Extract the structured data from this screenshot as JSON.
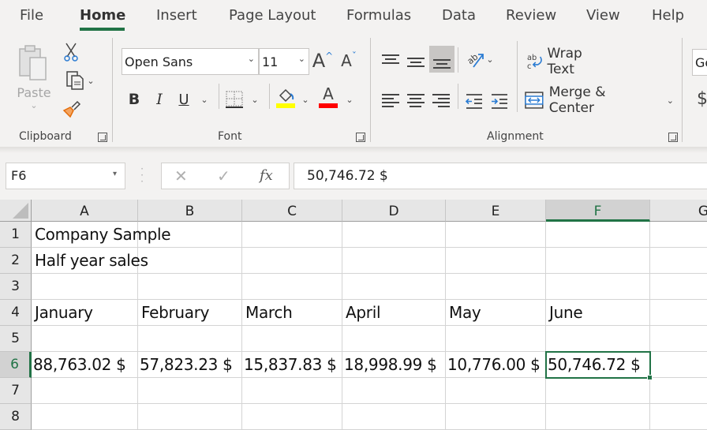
{
  "tabs": [
    {
      "label": "File",
      "active": false
    },
    {
      "label": "Home",
      "active": true
    },
    {
      "label": "Insert",
      "active": false
    },
    {
      "label": "Page Layout",
      "active": false
    },
    {
      "label": "Formulas",
      "active": false
    },
    {
      "label": "Data",
      "active": false
    },
    {
      "label": "Review",
      "active": false
    },
    {
      "label": "View",
      "active": false
    },
    {
      "label": "Help",
      "active": false
    }
  ],
  "ribbon": {
    "clipboard": {
      "label": "Clipboard",
      "paste_label": "Paste"
    },
    "font": {
      "label": "Font",
      "font_name": "Open Sans",
      "font_size": "11",
      "bold": "B",
      "italic": "I",
      "underline": "U",
      "fill_color": "#ffff00",
      "font_color": "#ff0000",
      "font_color_glyph": "A",
      "grow_glyph": "A",
      "shrink_glyph": "A"
    },
    "alignment": {
      "label": "Alignment",
      "wrap_text": "Wrap Text",
      "merge_center": "Merge & Center"
    },
    "number": {
      "format_value": "Ge",
      "currency_glyph": "$"
    }
  },
  "formula_bar": {
    "name_box": "F6",
    "fx_label": "fx",
    "cancel_glyph": "✕",
    "enter_glyph": "✓",
    "value": "50,746.72 $"
  },
  "sheet": {
    "columns": [
      "A",
      "B",
      "C",
      "D",
      "E",
      "F",
      "G"
    ],
    "selected_column": "F",
    "rows": [
      "1",
      "2",
      "3",
      "4",
      "5",
      "6",
      "7",
      "8"
    ],
    "selected_row": "6",
    "selected_cell": "F6",
    "cells": {
      "A1": "Company Sample",
      "A2": "Half year sales",
      "A4": "January",
      "B4": "February",
      "C4": "March",
      "D4": "April",
      "E4": "May",
      "F4": "June",
      "A6": "88,763.02 $",
      "B6": "57,823.23 $",
      "C6": "15,837.83 $",
      "D6": "18,998.99 $",
      "E6": "10,776.00 $",
      "F6": "50,746.72 $"
    },
    "accent_color": "#217346"
  }
}
